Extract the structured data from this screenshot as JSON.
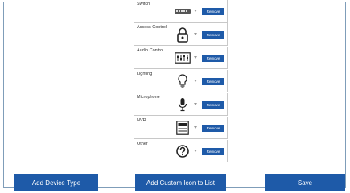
{
  "devices": [
    {
      "name": "Switch",
      "icon": "network-switch-icon",
      "remove_label": "Remove"
    },
    {
      "name": "Access Control",
      "icon": "padlock-icon",
      "remove_label": "Remove"
    },
    {
      "name": "Audio Control",
      "icon": "audio-mixer-icon",
      "remove_label": "Remove"
    },
    {
      "name": "Lighting",
      "icon": "light-bulb-icon",
      "remove_label": "Remove"
    },
    {
      "name": "Microphone",
      "icon": "microphone-icon",
      "remove_label": "Remove"
    },
    {
      "name": "NVR",
      "icon": "nvr-recorder-icon",
      "remove_label": "Remove"
    },
    {
      "name": "Other",
      "icon": "question-mark-icon",
      "remove_label": "Remove"
    }
  ],
  "footer": {
    "add_device_type": "Add Device Type",
    "add_custom_icon": "Add Custom Icon to List",
    "save": "Save"
  },
  "colors": {
    "button_blue": "#1e5aa8",
    "border": "#7f9db9"
  }
}
